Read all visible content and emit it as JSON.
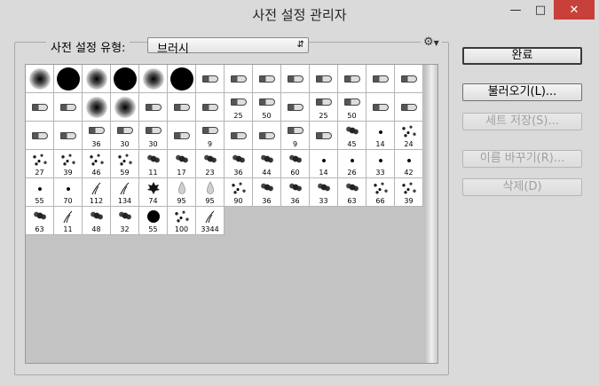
{
  "window": {
    "title": "사전 설정 관리자",
    "minimize_icon": "minimize-icon",
    "maximize_icon": "maximize-icon",
    "close_icon": "close-icon"
  },
  "preset_type": {
    "label": "사전 설정 유형:",
    "value": "브러시",
    "icon": "gear-icon"
  },
  "buttons": {
    "done": "완료",
    "load": "불러오기(L)...",
    "save_set": "세트 저장(S)...",
    "rename": "이름 바꾸기(R)...",
    "delete": "삭제(D)"
  },
  "brushes": [
    {
      "kind": "soft",
      "size": 1.0,
      "num": ""
    },
    {
      "kind": "hard",
      "size": 1.0,
      "num": ""
    },
    {
      "kind": "soft",
      "size": 1.0,
      "num": ""
    },
    {
      "kind": "hard",
      "size": 1.0,
      "num": ""
    },
    {
      "kind": "soft",
      "size": 1.0,
      "num": ""
    },
    {
      "kind": "hard",
      "size": 1.0,
      "num": ""
    },
    {
      "kind": "bristle",
      "size": 1,
      "num": ""
    },
    {
      "kind": "bristle",
      "size": 1,
      "num": ""
    },
    {
      "kind": "bristle",
      "size": 1,
      "num": ""
    },
    {
      "kind": "bristle",
      "size": 1,
      "num": ""
    },
    {
      "kind": "bristle",
      "size": 1,
      "num": ""
    },
    {
      "kind": "bristle",
      "size": 1,
      "num": ""
    },
    {
      "kind": "bristle",
      "size": 1,
      "num": ""
    },
    {
      "kind": "bristle",
      "size": 1,
      "num": ""
    },
    {
      "kind": "bristle",
      "size": 1,
      "num": ""
    },
    {
      "kind": "bristle",
      "size": 1,
      "num": ""
    },
    {
      "kind": "soft",
      "size": 1.0,
      "num": ""
    },
    {
      "kind": "soft",
      "size": 1.0,
      "num": ""
    },
    {
      "kind": "bristle",
      "size": 1,
      "num": ""
    },
    {
      "kind": "bristle",
      "size": 1,
      "num": ""
    },
    {
      "kind": "bristle",
      "size": 1,
      "num": ""
    },
    {
      "kind": "bristle",
      "size": 1,
      "num": "25"
    },
    {
      "kind": "bristle",
      "size": 1,
      "num": "50"
    },
    {
      "kind": "bristle",
      "size": 1,
      "num": ""
    },
    {
      "kind": "bristle",
      "size": 1,
      "num": "25"
    },
    {
      "kind": "bristle",
      "size": 1,
      "num": "50"
    },
    {
      "kind": "bristle",
      "size": 1,
      "num": ""
    },
    {
      "kind": "bristle",
      "size": 1,
      "num": ""
    },
    {
      "kind": "bristle",
      "size": 1,
      "num": ""
    },
    {
      "kind": "bristle",
      "size": 1,
      "num": ""
    },
    {
      "kind": "bristle",
      "size": 1,
      "num": "36"
    },
    {
      "kind": "bristle",
      "size": 1,
      "num": "30"
    },
    {
      "kind": "bristle",
      "size": 1,
      "num": "30"
    },
    {
      "kind": "bristle",
      "size": 1,
      "num": ""
    },
    {
      "kind": "bristle",
      "size": 1,
      "num": "9"
    },
    {
      "kind": "bristle",
      "size": 1,
      "num": ""
    },
    {
      "kind": "bristle",
      "size": 1,
      "num": ""
    },
    {
      "kind": "bristle",
      "size": 1,
      "num": "9"
    },
    {
      "kind": "bristle",
      "size": 1,
      "num": ""
    },
    {
      "kind": "splat",
      "size": 1,
      "num": "45"
    },
    {
      "kind": "dot",
      "size": 1,
      "num": "14"
    },
    {
      "kind": "scatter",
      "size": 1,
      "num": "24"
    },
    {
      "kind": "scatter",
      "size": 1,
      "num": "27"
    },
    {
      "kind": "scatter",
      "size": 1,
      "num": "39"
    },
    {
      "kind": "scatter",
      "size": 1,
      "num": "46"
    },
    {
      "kind": "scatter",
      "size": 1,
      "num": "59"
    },
    {
      "kind": "splat",
      "size": 1,
      "num": "11"
    },
    {
      "kind": "splat",
      "size": 1,
      "num": "17"
    },
    {
      "kind": "splat",
      "size": 1,
      "num": "23"
    },
    {
      "kind": "splat",
      "size": 1,
      "num": "36"
    },
    {
      "kind": "splat",
      "size": 1,
      "num": "44"
    },
    {
      "kind": "splat",
      "size": 1,
      "num": "60"
    },
    {
      "kind": "dot",
      "size": 1,
      "num": "14"
    },
    {
      "kind": "dot",
      "size": 1,
      "num": "26"
    },
    {
      "kind": "dot",
      "size": 1,
      "num": "33"
    },
    {
      "kind": "dot",
      "size": 1,
      "num": "42"
    },
    {
      "kind": "dot",
      "size": 1,
      "num": "55"
    },
    {
      "kind": "dot",
      "size": 1,
      "num": "70"
    },
    {
      "kind": "grass",
      "size": 1,
      "num": "112"
    },
    {
      "kind": "grass",
      "size": 1,
      "num": "134"
    },
    {
      "kind": "leaf",
      "size": 1,
      "num": "74"
    },
    {
      "kind": "drop",
      "size": 1,
      "num": "95"
    },
    {
      "kind": "drop",
      "size": 1,
      "num": "95"
    },
    {
      "kind": "scatter",
      "size": 1,
      "num": "90"
    },
    {
      "kind": "splat",
      "size": 1,
      "num": "36"
    },
    {
      "kind": "splat",
      "size": 1,
      "num": "36"
    },
    {
      "kind": "splat",
      "size": 1,
      "num": "33"
    },
    {
      "kind": "splat",
      "size": 1,
      "num": "63"
    },
    {
      "kind": "scatter",
      "size": 1,
      "num": "66"
    },
    {
      "kind": "scatter",
      "size": 1,
      "num": "39"
    },
    {
      "kind": "splat",
      "size": 1,
      "num": "63"
    },
    {
      "kind": "grass",
      "size": 1,
      "num": "11"
    },
    {
      "kind": "splat",
      "size": 1,
      "num": "48"
    },
    {
      "kind": "splat",
      "size": 1,
      "num": "32"
    },
    {
      "kind": "hard",
      "size": 0.5,
      "num": "55"
    },
    {
      "kind": "scatter",
      "size": 1,
      "num": "100"
    },
    {
      "kind": "grass",
      "size": 1,
      "num": "3344"
    }
  ]
}
